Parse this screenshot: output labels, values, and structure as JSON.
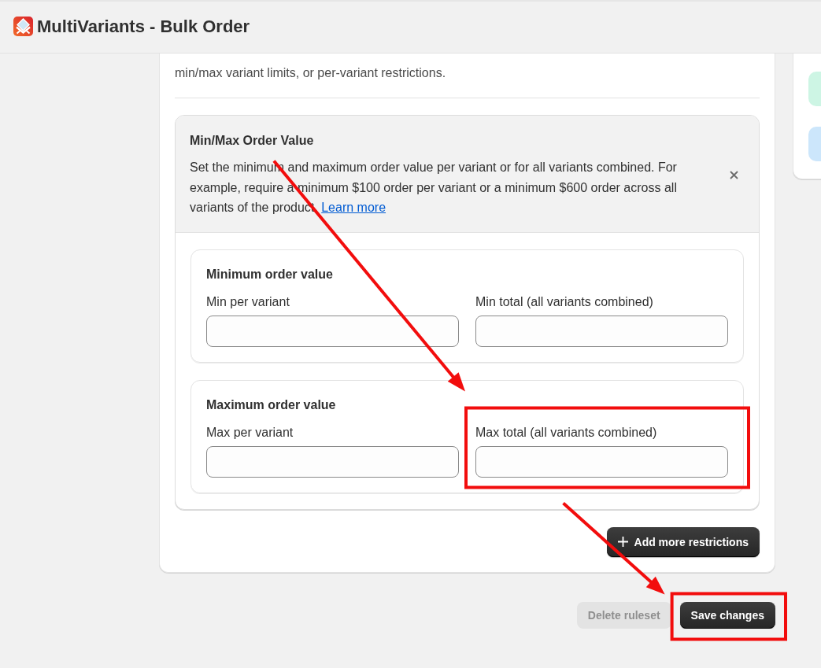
{
  "app_header": {
    "title": "MultiVariants - Bulk Order"
  },
  "restrictions_card": {
    "description": "min/max variant limits, or per-variant restrictions.",
    "restriction": {
      "title": "Min/Max Order Value",
      "description": "Set the minimum and maximum order value per variant or for all variants combined. For example, require a minimum $100 order per variant or a minimum $600 order across all variants of the product.",
      "link": "Learn more",
      "groups": [
        {
          "title": "Minimum order value",
          "fields": [
            {
              "label": "Min per variant",
              "highlighted": false
            },
            {
              "label": "Min total (all variants combined)",
              "highlighted": false
            }
          ]
        },
        {
          "title": "Maximum order value",
          "fields": [
            {
              "label": "Max per variant",
              "highlighted": false
            },
            {
              "label": "Max total (all variants combined)",
              "highlighted": true
            }
          ]
        }
      ]
    },
    "add_button": {
      "label": "Add more restrictions"
    }
  },
  "side_panel": {
    "tiles": [
      {
        "color": "#cdf5e4"
      },
      {
        "color": "#cce6fb"
      }
    ]
  },
  "footer_actions": [
    {
      "label": "Delete ruleset",
      "disabled": true,
      "highlighted": false
    },
    {
      "label": "Save changes",
      "disabled": false,
      "highlighted": true
    }
  ]
}
